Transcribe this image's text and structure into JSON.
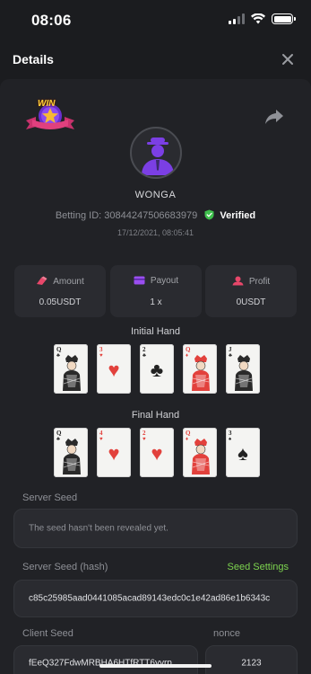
{
  "status_bar": {
    "time": "08:06"
  },
  "header": {
    "title": "Details",
    "close_icon": "close-icon"
  },
  "badge": {
    "text": "WIN"
  },
  "player": {
    "name": "WONGA",
    "betting_id_text": "Betting ID: 30844247506683979",
    "verified_label": "Verified",
    "timestamp": "17/12/2021, 08:05:41"
  },
  "stats": {
    "amount": {
      "label": "Amount",
      "value": "0.05USDT",
      "icon": "coin-icon"
    },
    "payout": {
      "label": "Payout",
      "value": "1 x",
      "icon": "wallet-icon"
    },
    "profit": {
      "label": "Profit",
      "value": "0USDT",
      "icon": "profit-icon"
    }
  },
  "initial_hand": {
    "title": "Initial Hand",
    "cards": [
      {
        "rank": "Q",
        "suit": "♣",
        "color": "black",
        "face": true
      },
      {
        "rank": "3",
        "suit": "♥",
        "color": "red",
        "face": false
      },
      {
        "rank": "2",
        "suit": "♣",
        "color": "black",
        "face": false
      },
      {
        "rank": "Q",
        "suit": "♦",
        "color": "red",
        "face": true
      },
      {
        "rank": "J",
        "suit": "♣",
        "color": "black",
        "face": true
      }
    ]
  },
  "final_hand": {
    "title": "Final Hand",
    "cards": [
      {
        "rank": "Q",
        "suit": "♣",
        "color": "black",
        "face": true
      },
      {
        "rank": "4",
        "suit": "♥",
        "color": "red",
        "face": false
      },
      {
        "rank": "2",
        "suit": "♥",
        "color": "red",
        "face": false
      },
      {
        "rank": "Q",
        "suit": "♦",
        "color": "red",
        "face": true
      },
      {
        "rank": "3",
        "suit": "♠",
        "color": "black",
        "face": false
      }
    ]
  },
  "server_seed": {
    "label": "Server Seed",
    "value": "The seed hasn't been revealed yet."
  },
  "server_seed_hash": {
    "label": "Server Seed (hash)",
    "settings_link": "Seed Settings",
    "value": "c85c25985aad0441085acad89143edc0c1e42ad86e1b6343c"
  },
  "client_seed": {
    "label": "Client Seed",
    "value": "fEeQ327FdwMRBHA6HTfRTT6yyrp"
  },
  "nonce": {
    "label": "nonce",
    "value": "2123"
  },
  "colors": {
    "background": "#1b1c1f",
    "panel": "#2a2b30",
    "accent_green": "#7dd44f",
    "verified_green": "#3fc04d",
    "avatar_purple": "#7b3fe4"
  }
}
